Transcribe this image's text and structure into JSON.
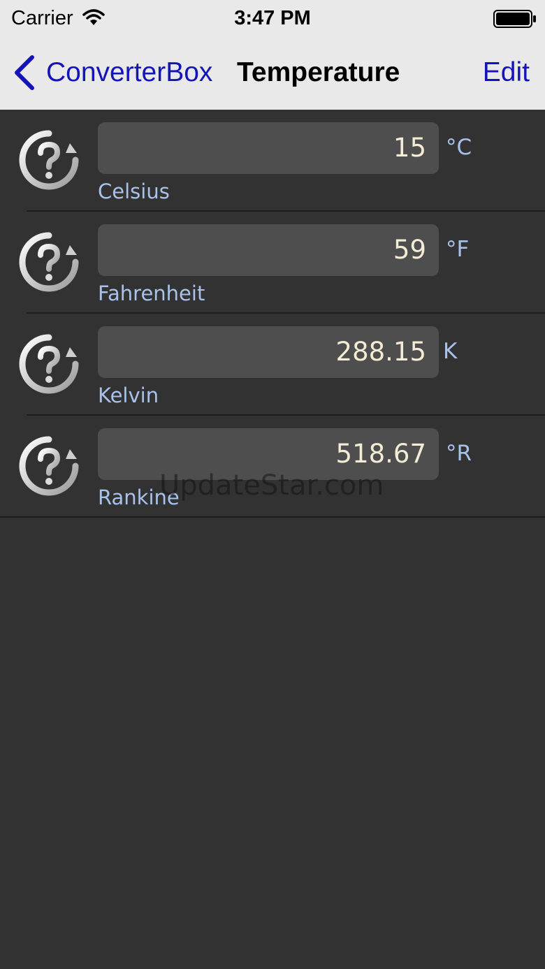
{
  "status_bar": {
    "carrier": "Carrier",
    "time": "3:47 PM"
  },
  "nav": {
    "back_label": "ConverterBox",
    "title": "Temperature",
    "edit_label": "Edit"
  },
  "units": [
    {
      "value": "15",
      "symbol": "°C",
      "name": "Celsius"
    },
    {
      "value": "59",
      "symbol": "°F",
      "name": "Fahrenheit"
    },
    {
      "value": "288.15",
      "symbol": "K",
      "name": "Kelvin"
    },
    {
      "value": "518.67",
      "symbol": "°R",
      "name": "Rankine"
    }
  ],
  "watermark": "UpdateStar.com",
  "icons": {
    "help": "help-question-icon",
    "back": "chevron-left-icon",
    "wifi": "wifi-icon",
    "battery": "battery-icon"
  },
  "colors": {
    "accent": "#1414b8",
    "label": "#a9c2ea",
    "value": "#f4ecd6",
    "background": "#323232",
    "field": "#4e4e4e"
  }
}
